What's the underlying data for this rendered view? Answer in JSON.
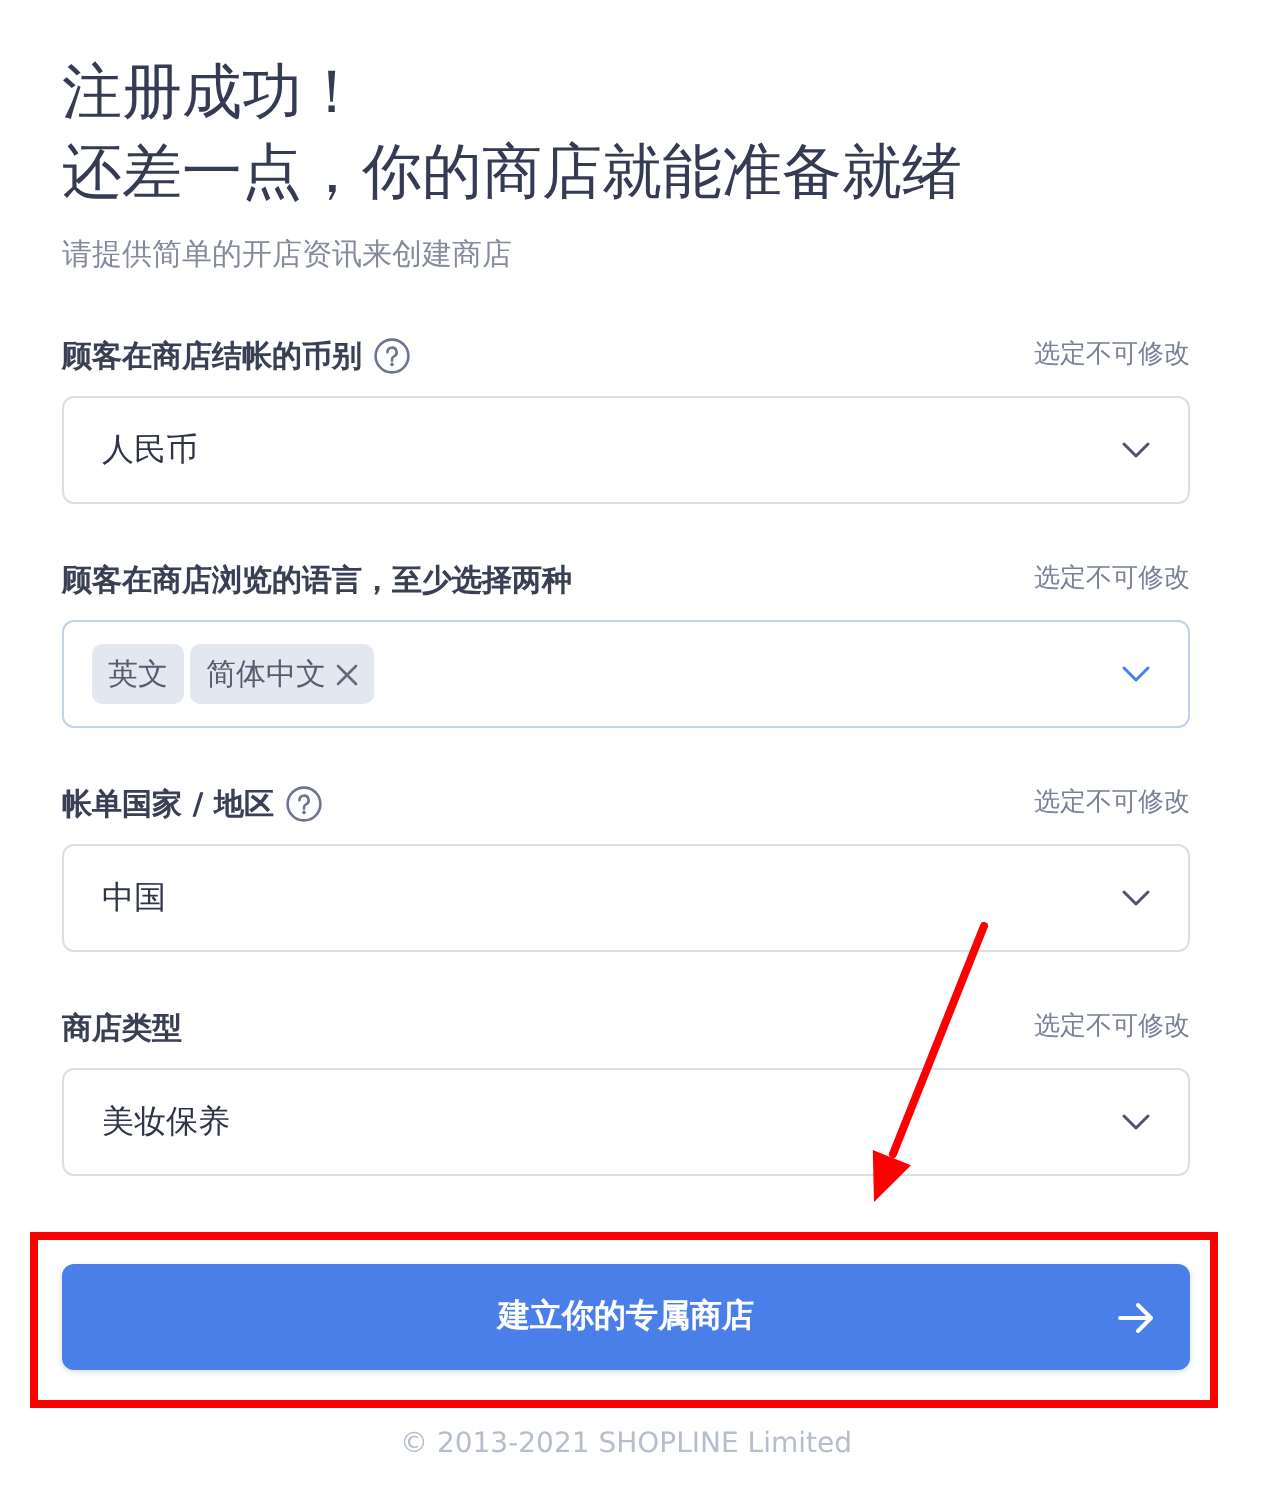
{
  "title_lines": [
    "注册成功！",
    "还差一点，你的商店就能准备就绪"
  ],
  "subtitle": "请提供简单的开店资讯来创建商店",
  "fields": [
    {
      "kind": "select",
      "label": "顾客在商店结帐的币别",
      "help": true,
      "note": "选定不可修改",
      "value": "人民币",
      "focused": false
    },
    {
      "kind": "multiselect",
      "label": "顾客在商店浏览的语言，至少选择两种",
      "help": false,
      "note": "选定不可修改",
      "chips": [
        {
          "label": "英文",
          "removable": false
        },
        {
          "label": "简体中文",
          "removable": true
        }
      ],
      "focused": true
    },
    {
      "kind": "select",
      "label": "帐单国家 / 地区",
      "help": true,
      "note": "选定不可修改",
      "value": "中国",
      "focused": false
    },
    {
      "kind": "select",
      "label": "商店类型",
      "help": false,
      "note": "选定不可修改",
      "value": "美妆保养",
      "focused": false
    }
  ],
  "submit": {
    "label": "建立你的专属商店"
  },
  "footer": "© 2013-2021 SHOPLINE Limited"
}
